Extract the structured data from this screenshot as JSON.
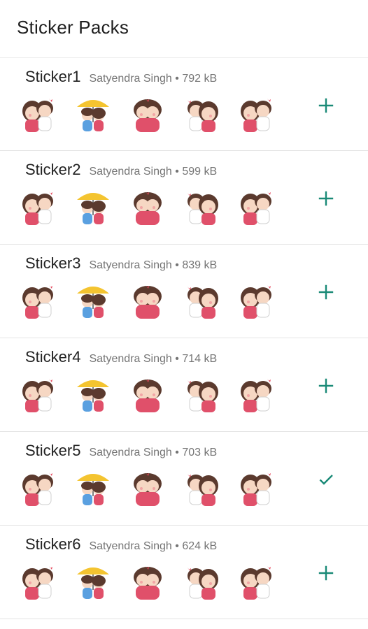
{
  "app": {
    "title": "Sticker Packs"
  },
  "colors": {
    "accent": "#1a8a77",
    "hair": "#5b3a2e",
    "skin": "#f6d7c3",
    "cheek": "#f2a5a5",
    "dress": "#e0506a"
  },
  "packs": [
    {
      "name": "Sticker1",
      "publisher": "Satyendra Singh",
      "separator": "•",
      "size": "792 kB",
      "action": "add"
    },
    {
      "name": "Sticker2",
      "publisher": "Satyendra Singh",
      "separator": "•",
      "size": "599 kB",
      "action": "add"
    },
    {
      "name": "Sticker3",
      "publisher": "Satyendra Singh",
      "separator": "•",
      "size": "839 kB",
      "action": "add"
    },
    {
      "name": "Sticker4",
      "publisher": "Satyendra Singh",
      "separator": "•",
      "size": "714 kB",
      "action": "add"
    },
    {
      "name": "Sticker5",
      "publisher": "Satyendra Singh",
      "separator": "•",
      "size": "703 kB",
      "action": "added"
    },
    {
      "name": "Sticker6",
      "publisher": "Satyendra Singh",
      "separator": "•",
      "size": "624 kB",
      "action": "add"
    }
  ]
}
